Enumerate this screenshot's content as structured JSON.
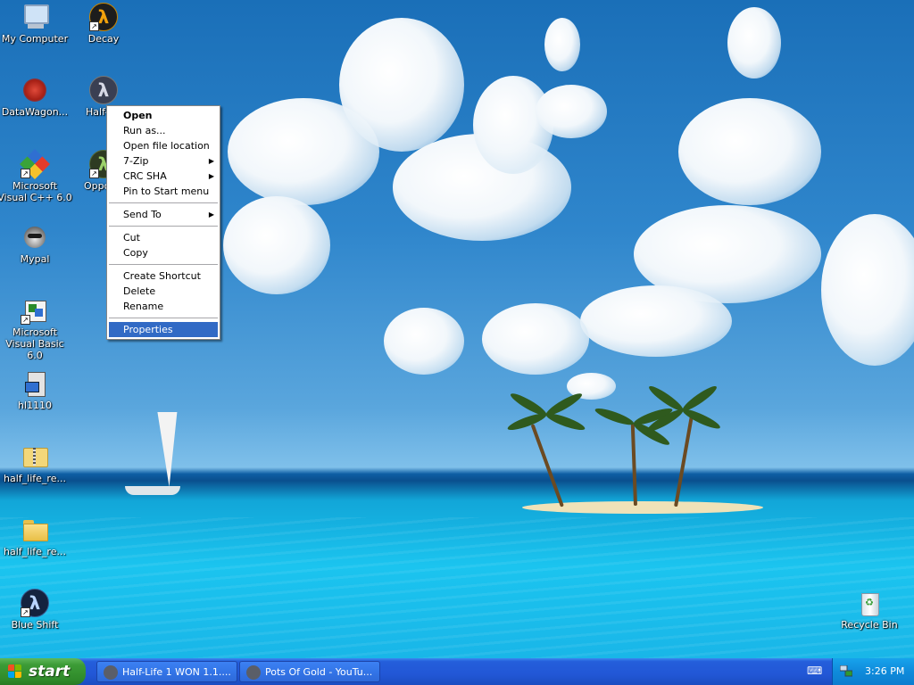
{
  "desktop": {
    "icons": [
      {
        "label": "My Computer",
        "icon": "my-computer-icon"
      },
      {
        "label": "Decay",
        "icon": "half-life-lambda-icon"
      },
      {
        "label": "DataWagon...",
        "icon": "datawagon-icon"
      },
      {
        "label": "Half-",
        "icon": "half-life-lambda-icon"
      },
      {
        "label": "Microsoft Visual C++ 6.0",
        "icon": "visual-cpp-icon"
      },
      {
        "label": "Oppo Fo",
        "icon": "opposing-force-icon"
      },
      {
        "label": "Mypal",
        "icon": "mypal-raccoon-icon"
      },
      {
        "label": "Microsoft Visual Basic 6.0",
        "icon": "visual-basic-icon"
      },
      {
        "label": "hl1110",
        "icon": "installer-icon"
      },
      {
        "label": "half_life_re...",
        "icon": "zip-folder-icon"
      },
      {
        "label": "half_life_re...",
        "icon": "folder-icon"
      },
      {
        "label": "Blue Shift",
        "icon": "blue-shift-lambda-icon"
      },
      {
        "label": "Recycle Bin",
        "icon": "recycle-bin-icon"
      }
    ]
  },
  "context_menu": {
    "items": [
      {
        "label": "Open",
        "bold": true
      },
      {
        "label": "Run as..."
      },
      {
        "label": "Open file location"
      },
      {
        "label": "7-Zip",
        "submenu": true
      },
      {
        "label": "CRC SHA",
        "submenu": true
      },
      {
        "label": "Pin to Start menu"
      },
      {
        "label": "Send To",
        "submenu": true
      },
      {
        "label": "Cut"
      },
      {
        "label": "Copy"
      },
      {
        "label": "Create Shortcut"
      },
      {
        "label": "Delete"
      },
      {
        "label": "Rename"
      },
      {
        "label": "Properties",
        "selected": true
      }
    ]
  },
  "taskbar": {
    "start_label": "start",
    "tasks": [
      {
        "label": "Half-Life 1 WON 1.1....",
        "icon": "mypal-raccoon-icon"
      },
      {
        "label": "Pots Of Gold - YouTu...",
        "icon": "mypal-raccoon-icon"
      }
    ],
    "clock": "3:26 PM"
  },
  "colors": {
    "menu_highlight": "#316ac5",
    "taskbar_blue": "#245edb",
    "start_green": "#3c9b36",
    "tray_blue": "#0f8bdb"
  }
}
